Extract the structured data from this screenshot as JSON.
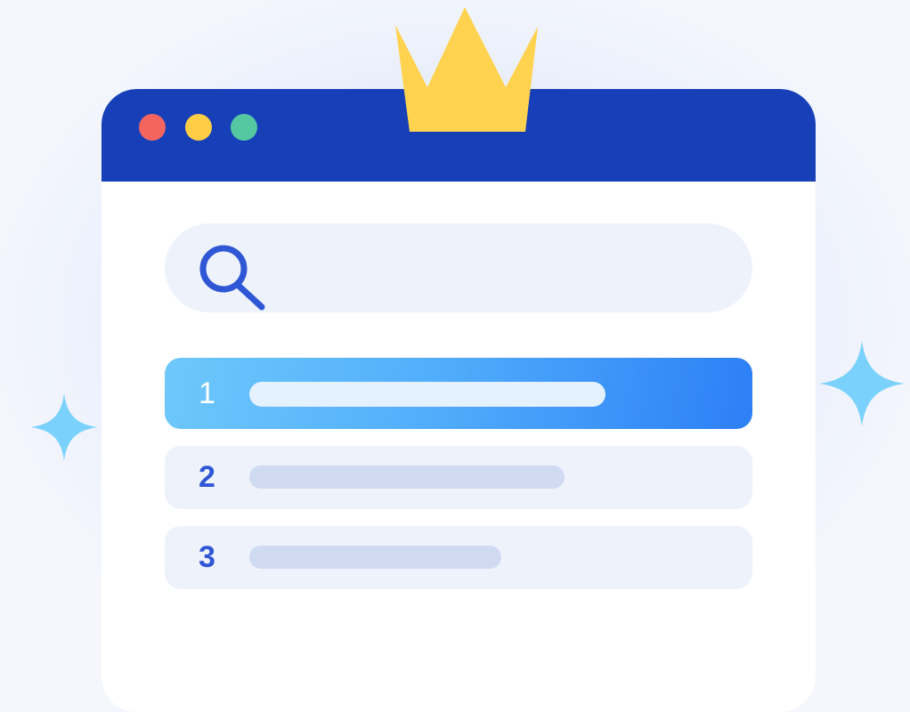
{
  "colors": {
    "titlebar": "#173fb8",
    "dot_red": "#f4655f",
    "dot_yellow": "#fdcd45",
    "dot_green": "#55c8a1",
    "crown": "#ffd24f",
    "search_icon": "#2f57d5",
    "sparkle": "#7ad2fc",
    "row_highlight_start": "#6ec8fb",
    "row_highlight_end": "#2c7ff6"
  },
  "window": {
    "controls": [
      "close-dot",
      "minimize-dot",
      "maximize-dot"
    ]
  },
  "search": {
    "icon": "search-icon"
  },
  "results": [
    {
      "rank": "1",
      "highlighted": true
    },
    {
      "rank": "2",
      "highlighted": false
    },
    {
      "rank": "3",
      "highlighted": false
    }
  ],
  "decorations": [
    "crown-icon",
    "sparkle-icon",
    "sparkle-icon"
  ]
}
